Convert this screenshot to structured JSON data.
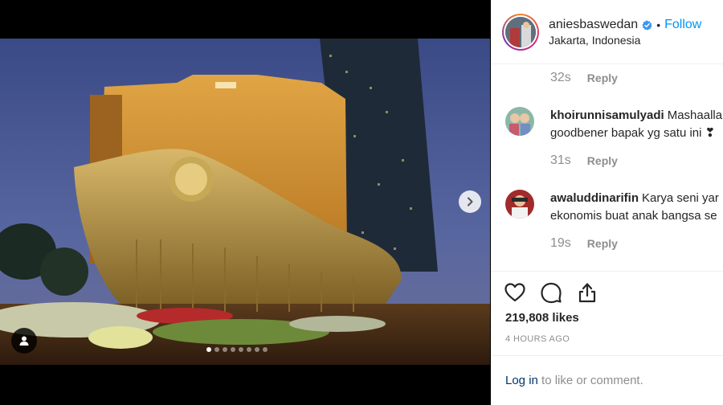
{
  "post": {
    "username": "aniesbaswedan",
    "separator": "•",
    "follow_label": "Follow",
    "location": "Jakarta, Indonesia",
    "icons": {
      "verified": "verified-badge-icon",
      "next": "chevron-right-icon",
      "user_tag": "user-tag-icon",
      "like": "heart-icon",
      "comment": "comment-icon",
      "share": "share-icon"
    },
    "carousel": {
      "slide_count": 8,
      "active_index": 0
    }
  },
  "comments": {
    "top_meta": {
      "time": "32s",
      "reply": "Reply"
    },
    "items": [
      {
        "user": "khoirunnisamulyadi",
        "text_line1": "Mashaalla",
        "text_line2": "goodbener bapak yg satu ini ❣",
        "time": "31s",
        "reply": "Reply"
      },
      {
        "user": "awaluddinarifin",
        "text_line1": "Karya seni yar",
        "text_line2": "ekonomis buat anak bangsa se",
        "time": "19s",
        "reply": "Reply"
      }
    ]
  },
  "stats": {
    "likes": "219,808 likes",
    "time_ago": "4 HOURS AGO"
  },
  "login": {
    "link": "Log in",
    "rest": " to like or comment."
  },
  "colors": {
    "follow": "#0095f6",
    "verified": "#3897f0",
    "muted": "#8e8e8e",
    "text": "#262626"
  }
}
